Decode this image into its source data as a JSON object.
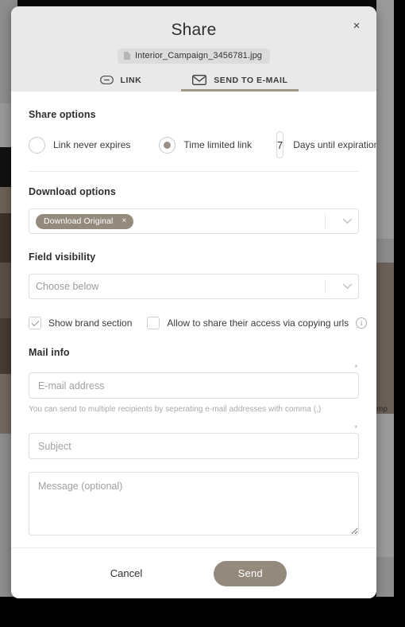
{
  "background": {
    "clipped_text": "mp"
  },
  "modal": {
    "title": "Share",
    "close_label": "×",
    "file": {
      "name": "Interior_Campaign_3456781.jpg",
      "icon": "document-icon"
    },
    "tabs": [
      {
        "id": "link",
        "label": "LINK",
        "icon": "link-icon",
        "active": false
      },
      {
        "id": "email",
        "label": "SEND TO E-MAIL",
        "icon": "envelope-icon",
        "active": true
      }
    ],
    "share_options": {
      "title": "Share options",
      "radios": [
        {
          "id": "never",
          "label": "Link never expires",
          "selected": false
        },
        {
          "id": "limited",
          "label": "Time limited link",
          "selected": true
        }
      ],
      "days_value": "7",
      "days_label": "Days until expiration"
    },
    "download_options": {
      "title": "Download options",
      "tags": [
        {
          "label": "Download Original",
          "remove": "×"
        }
      ],
      "chevron": "chevron-down-icon"
    },
    "field_visibility": {
      "title": "Field visibility",
      "placeholder": "Choose below",
      "chevron": "chevron-down-icon"
    },
    "checkboxes": [
      {
        "id": "brand",
        "label": "Show brand section",
        "checked": true
      },
      {
        "id": "copy-urls",
        "label": "Allow to share their access via copying urls",
        "checked": false
      }
    ],
    "info_icon_label": "i",
    "mail_info": {
      "title": "Mail info",
      "required_marker": "*",
      "email_placeholder": "E-mail address",
      "email_value": "",
      "email_helper": "You can send to multiple recipients by seperating e-mail addresses with comma (,)",
      "subject_placeholder": "Subject",
      "subject_value": "",
      "message_placeholder": "Message (optional)",
      "message_value": ""
    },
    "footer": {
      "cancel_label": "Cancel",
      "send_label": "Send"
    }
  },
  "colors": {
    "accent": "#938a7d",
    "tag": "#948a7d",
    "header_bg": "#e9e9e9",
    "tab_underline": "#a0968a"
  }
}
